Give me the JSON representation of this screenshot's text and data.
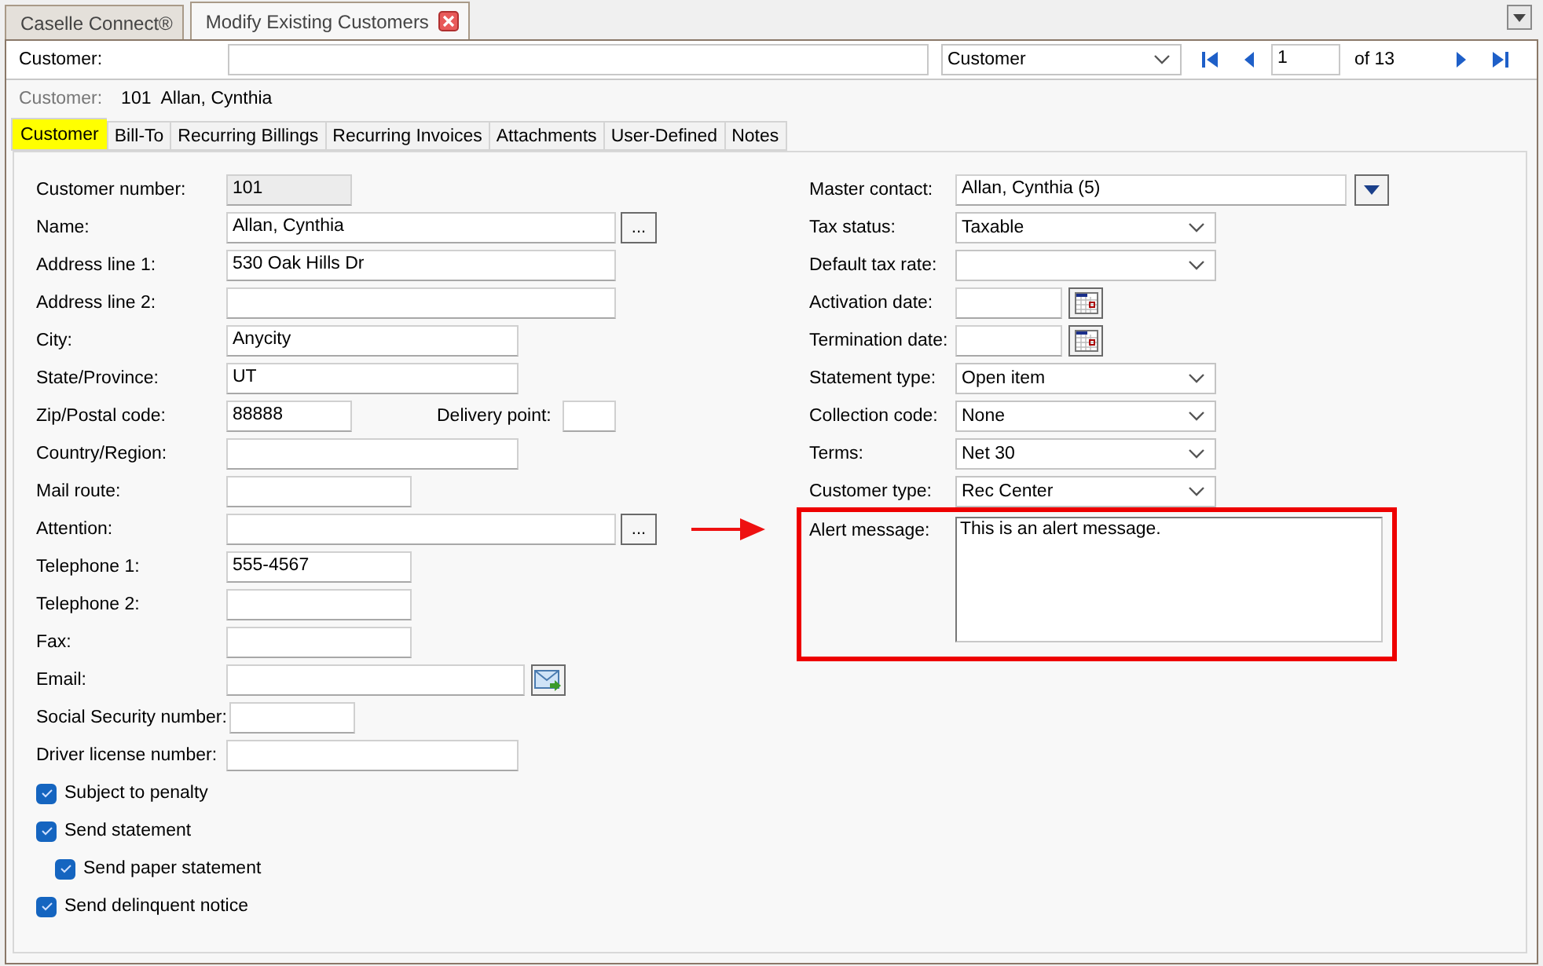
{
  "document_tabs": [
    {
      "label": "Caselle Connect®",
      "selected": false,
      "closable": false
    },
    {
      "label": "Modify Existing Customers",
      "selected": true,
      "closable": true
    }
  ],
  "search": {
    "label": "Customer:",
    "search_by": "Customer",
    "record": "1",
    "record_count": "of 13"
  },
  "current": {
    "label": "Customer:",
    "number": "101",
    "name": "Allan, Cynthia"
  },
  "tabs": [
    {
      "label": "Customer",
      "selected": true
    },
    {
      "label": "Bill-To",
      "selected": false
    },
    {
      "label": "Recurring Billings",
      "selected": false
    },
    {
      "label": "Recurring Invoices",
      "selected": false
    },
    {
      "label": "Attachments",
      "selected": false
    },
    {
      "label": "User-Defined",
      "selected": false
    },
    {
      "label": "Notes",
      "selected": false
    }
  ],
  "left_fields": [
    {
      "label": "Customer number:",
      "value": "101",
      "kind": "readonly"
    },
    {
      "label": "Name:",
      "value": "Allan, Cynthia",
      "kind": "lookup",
      "button": "..."
    },
    {
      "label": "Address line 1:",
      "value": "530 Oak Hills Dr",
      "kind": "text"
    },
    {
      "label": "Address line 2:",
      "kind": "text"
    },
    {
      "label": "City:",
      "value": "Anycity",
      "kind": "text"
    },
    {
      "label": "State/Province:",
      "value": "UT",
      "kind": "text"
    },
    {
      "label": "Zip/Postal code:",
      "value": "88888",
      "kind": "text",
      "extra_label": "Delivery point:"
    },
    {
      "label": "Country/Region:",
      "kind": "text"
    },
    {
      "label": "Mail route:",
      "kind": "text"
    },
    {
      "label": "Attention:",
      "kind": "lookup",
      "button": "..."
    },
    {
      "label": "Telephone 1:",
      "value": "555-4567",
      "kind": "text"
    },
    {
      "label": "Telephone 2:",
      "kind": "text"
    },
    {
      "label": "Fax:",
      "kind": "text"
    },
    {
      "label": "Email:",
      "kind": "email"
    },
    {
      "label": "Social Security number:",
      "kind": "text"
    },
    {
      "label": "Driver license number:",
      "kind": "text"
    }
  ],
  "options": [
    {
      "label": "Subject to penalty",
      "checked": true
    },
    {
      "label": "Send statement",
      "checked": true,
      "children": [
        {
          "label": "Send paper statement",
          "checked": true
        }
      ]
    },
    {
      "label": "Send delinquent notice",
      "checked": true
    }
  ],
  "right_fields": [
    {
      "label": "Master contact:",
      "value": "Allan, Cynthia (5)",
      "kind": "contact"
    },
    {
      "label": "Tax status:",
      "value": "Taxable",
      "kind": "select"
    },
    {
      "label": "Default tax rate:",
      "kind": "select"
    },
    {
      "label": "Activation date:",
      "kind": "date"
    },
    {
      "label": "Termination date:",
      "kind": "date"
    },
    {
      "label": "Statement type:",
      "value": "Open item",
      "kind": "select"
    },
    {
      "label": "Collection code:",
      "value": "None",
      "kind": "select"
    },
    {
      "label": "Terms:",
      "value": "Net 30",
      "kind": "select"
    },
    {
      "label": "Customer type:",
      "value": "Rec Center",
      "kind": "select"
    }
  ],
  "alert": {
    "label": "Alert message:",
    "value": "This is an alert message.",
    "highlighted": true
  }
}
